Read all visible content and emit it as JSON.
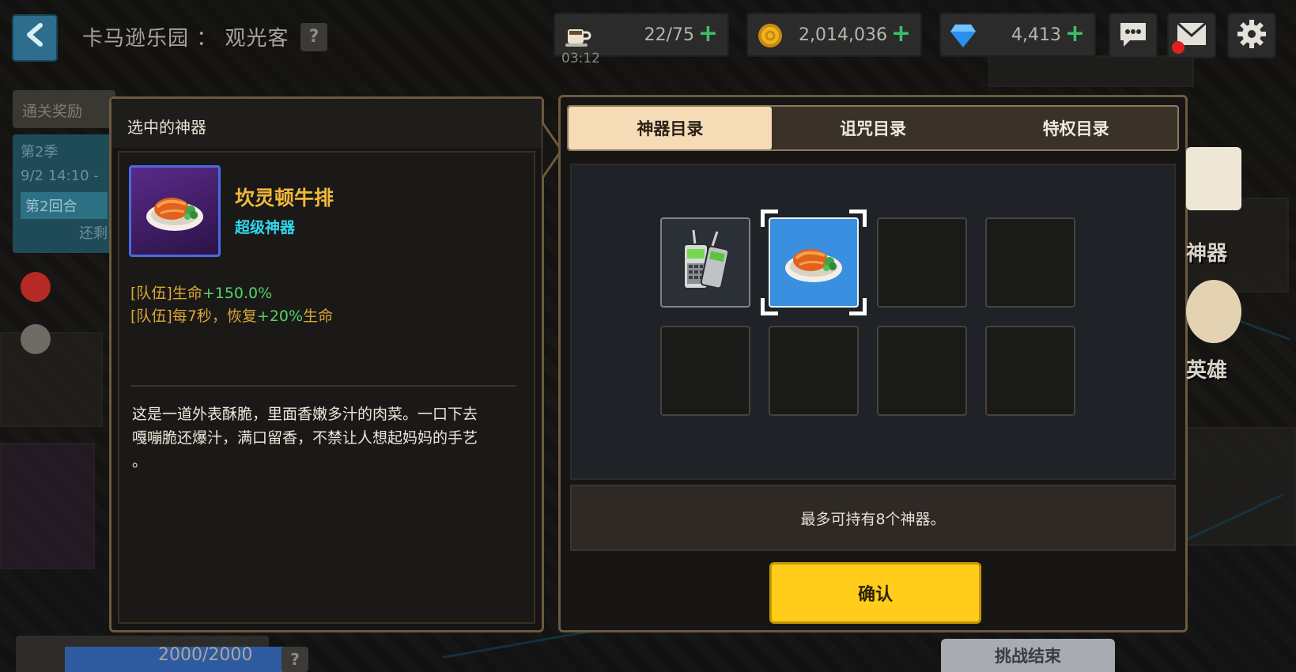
{
  "header": {
    "back_label": "<",
    "stage_title": "卡马逊乐园 ： 观光客",
    "help_label": "?",
    "stamina": {
      "value": "22/75",
      "timer": "03:12",
      "plus": "+"
    },
    "gold": {
      "value": "2,014,036",
      "plus": "+"
    },
    "gems": {
      "value": "4,413",
      "plus": "+"
    }
  },
  "left_panel": {
    "reward_tab": "通关奖励",
    "season": "第2季",
    "date": "9/2 14:10 -",
    "round": "第2回合",
    "remaining": "还剩"
  },
  "detail": {
    "header": "选中的神器",
    "item_name": "坎灵顿牛排",
    "item_rank": "超级神器",
    "effect1_prefix": "[队伍]生命",
    "effect1_value": "+150.0%",
    "effect2_prefix": "[队伍]每7秒，恢复",
    "effect2_value": "+20%",
    "effect2_suffix": "生命",
    "description_line1": "这是一道外表酥脆，里面香嫩多汁的肉菜。一口下去",
    "description_line2": "嘎嘣脆还爆汁，满口留香，不禁让人想起妈妈的手艺",
    "description_line3": "。"
  },
  "catalog": {
    "tabs": [
      "神器目录",
      "诅咒目录",
      "特权目录"
    ],
    "active_tab": 0,
    "slots": [
      {
        "item": "walkie-talkie"
      },
      {
        "item": "steak",
        "selected": true
      },
      {
        "item": ""
      },
      {
        "item": ""
      },
      {
        "item": ""
      },
      {
        "item": ""
      },
      {
        "item": ""
      },
      {
        "item": ""
      }
    ],
    "capacity_text": "最多可持有8个神器。",
    "confirm_label": "确认"
  },
  "side": {
    "artifact_label": "神器",
    "hero_label": "英雄"
  },
  "bottom": {
    "hp_text": "2000/2000",
    "help_label": "?",
    "end_label": "挑战结束"
  },
  "colors": {
    "accent_yellow": "#ffcd1a",
    "rank_cyan": "#2fd6ee",
    "item_gold": "#f2b93b",
    "stat_green": "#56d16a",
    "selected_blue": "#3a8fe0"
  }
}
